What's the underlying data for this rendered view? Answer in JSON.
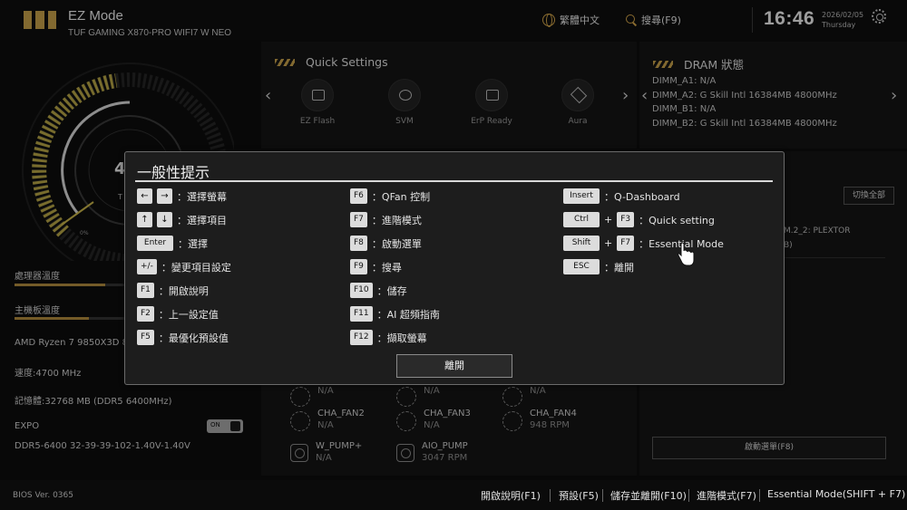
{
  "header": {
    "mode": "EZ Mode",
    "board": "TUF GAMING X870-PRO WIFI7 W NEO",
    "language": "繁體中文",
    "search": "搜尋(F9)",
    "time": "16:46",
    "date": "2026/02/05",
    "weekday": "Thursday",
    "accent": "#c8a24a"
  },
  "quick_settings": {
    "title": "Quick Settings",
    "items": [
      {
        "label": "EZ Flash",
        "icon": "ez-flash-icon"
      },
      {
        "label": "SVM",
        "icon": "cpu-gear-icon"
      },
      {
        "label": "ErP Ready",
        "icon": "erp-icon"
      },
      {
        "label": "Aura",
        "icon": "aura-icon"
      }
    ]
  },
  "dram": {
    "title": "DRAM 狀態",
    "slots": [
      {
        "name": "DIMM_A1:",
        "value": "N/A"
      },
      {
        "name": "DIMM_A2:",
        "value": "G Skill Intl 16384MB 4800MHz"
      },
      {
        "name": "DIMM_B1:",
        "value": "N/A"
      },
      {
        "name": "DIMM_B2:",
        "value": "G Skill Intl 16384MB 4800MHz"
      }
    ]
  },
  "left": {
    "cpu_temp_label": "處理器溫度",
    "mb_temp_label": "主機板溫度",
    "cpu_name": "AMD Ryzen 7 9850X3D 8-",
    "speed": "速度:4700 MHz",
    "memory": "記憶體:32768 MB (DDR5 6400MHz)",
    "expo_label": "EXPO",
    "expo_toggle": "ON",
    "expo_profile": "DDR5-6400 32-39-39-102-1.40V-1.40V",
    "gauge_digit": "4",
    "gauge_unit": "T",
    "gauge_zero": "0%"
  },
  "storage": {
    "switch_all": "切換全部",
    "line1": "M.2_2: PLEXTOR",
    "line2": "B)"
  },
  "fans": [
    {
      "name": "",
      "value": "N/A",
      "kind": "fan"
    },
    {
      "name": "",
      "value": "N/A",
      "kind": "fan"
    },
    {
      "name": "",
      "value": "N/A",
      "kind": "fan"
    },
    {
      "name": "CHA_FAN2",
      "value": "N/A",
      "kind": "fan"
    },
    {
      "name": "CHA_FAN3",
      "value": "N/A",
      "kind": "fan"
    },
    {
      "name": "CHA_FAN4",
      "value": "948 RPM",
      "kind": "fan"
    },
    {
      "name": "W_PUMP+",
      "value": "N/A",
      "kind": "pump"
    },
    {
      "name": "AIO_PUMP",
      "value": "3047 RPM",
      "kind": "pump"
    }
  ],
  "boot_menu": "啟動選單(F8)",
  "footer": {
    "bios_version": "BIOS Ver. 0365",
    "items": [
      "開啟說明(F1)",
      "預設(F5)",
      "儲存並離開(F10)",
      "進階模式(F7)",
      "Essential Mode(SHIFT + F7)"
    ]
  },
  "dialog": {
    "title": "一般性提示",
    "close": "離開",
    "col1": [
      {
        "keys": [
          "←",
          "→"
        ],
        "desc": "：選擇螢幕"
      },
      {
        "keys": [
          "↑",
          "↓"
        ],
        "desc": "：選擇項目"
      },
      {
        "keys": [
          "Enter"
        ],
        "desc": "：選擇"
      },
      {
        "keys": [
          "+/-"
        ],
        "desc": "：變更項目設定"
      },
      {
        "keys": [
          "F1"
        ],
        "desc": "：開啟說明"
      },
      {
        "keys": [
          "F2"
        ],
        "desc": "：上一設定值"
      },
      {
        "keys": [
          "F5"
        ],
        "desc": "：最優化預設值"
      }
    ],
    "col2": [
      {
        "keys": [
          "F6"
        ],
        "desc": "：QFan 控制"
      },
      {
        "keys": [
          "F7"
        ],
        "desc": "：進階模式"
      },
      {
        "keys": [
          "F8"
        ],
        "desc": "：啟動選單"
      },
      {
        "keys": [
          "F9"
        ],
        "desc": "：搜尋"
      },
      {
        "keys": [
          "F10"
        ],
        "desc": "：儲存"
      },
      {
        "keys": [
          "F11"
        ],
        "desc": "：AI 超頻指南"
      },
      {
        "keys": [
          "F12"
        ],
        "desc": "：擷取螢幕"
      }
    ],
    "col3": [
      {
        "keys": [
          "Insert"
        ],
        "desc": "：Q-Dashboard"
      },
      {
        "keys": [
          "Ctrl",
          "F3"
        ],
        "desc": "：Quick setting"
      },
      {
        "keys": [
          "Shift",
          "F7"
        ],
        "desc": "：Essential Mode"
      },
      {
        "keys": [
          "ESC"
        ],
        "desc": "：離開"
      }
    ]
  }
}
